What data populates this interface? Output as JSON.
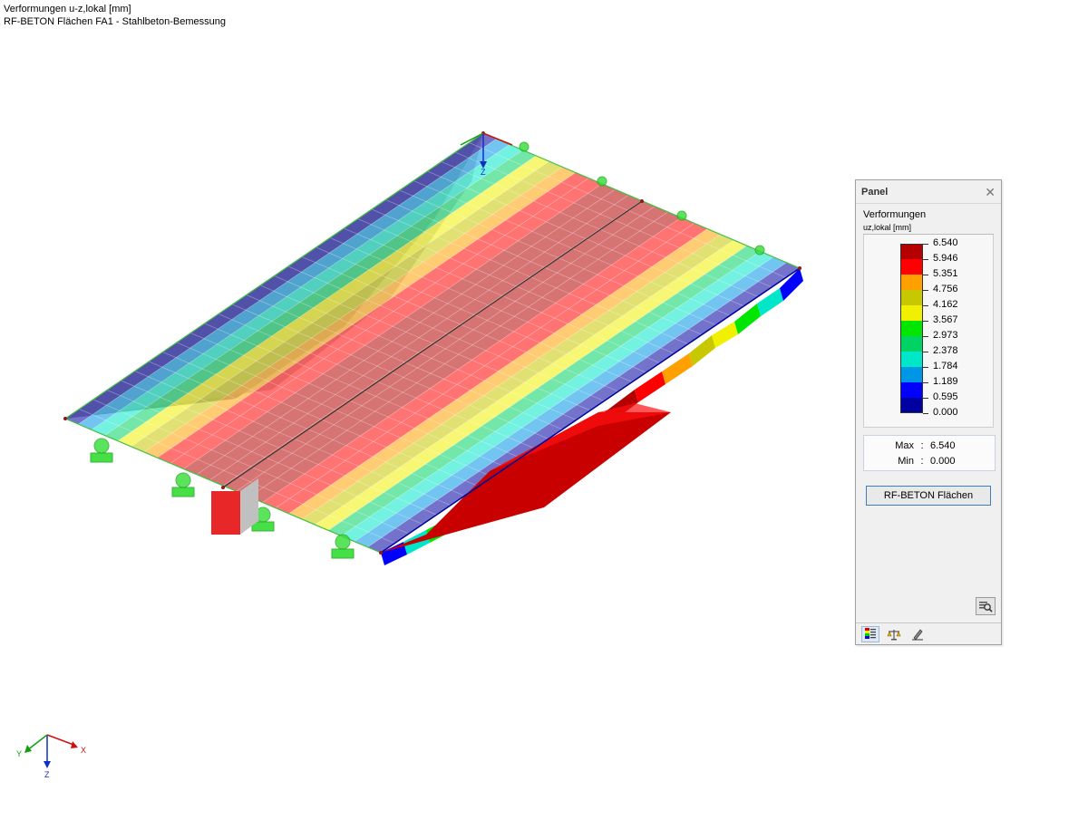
{
  "view": {
    "title_line1": "Verformungen u-z,lokal [mm]",
    "title_line2": "RF-BETON Flächen FA1 - Stahlbeton-Bemessung"
  },
  "axes": {
    "x": "X",
    "y": "Y",
    "z": "Z"
  },
  "panel": {
    "title": "Panel",
    "close_icon": "close-icon",
    "section_title": "Verformungen",
    "section_sub": "uz,lokal [mm]",
    "legend": [
      {
        "value": "6.540",
        "color": "#b40000"
      },
      {
        "value": "5.946",
        "color": "#ff0000"
      },
      {
        "value": "5.351",
        "color": "#ffa000"
      },
      {
        "value": "4.756",
        "color": "#c8c800"
      },
      {
        "value": "4.162",
        "color": "#f0f000"
      },
      {
        "value": "3.567",
        "color": "#00e600"
      },
      {
        "value": "2.973",
        "color": "#00d264"
      },
      {
        "value": "2.378",
        "color": "#00e6c8"
      },
      {
        "value": "1.784",
        "color": "#0096e6"
      },
      {
        "value": "1.189",
        "color": "#0000ff"
      },
      {
        "value": "0.595",
        "color": "#0000a0"
      },
      {
        "value": "0.000",
        "color": null
      }
    ],
    "max_label": "Max",
    "max_value": "6.540",
    "min_label": "Min",
    "min_value": "0.000",
    "button_label": "RF-BETON Flächen",
    "toolbar": [
      "color-scale-icon",
      "balance-icon",
      "pencil-icon"
    ]
  }
}
